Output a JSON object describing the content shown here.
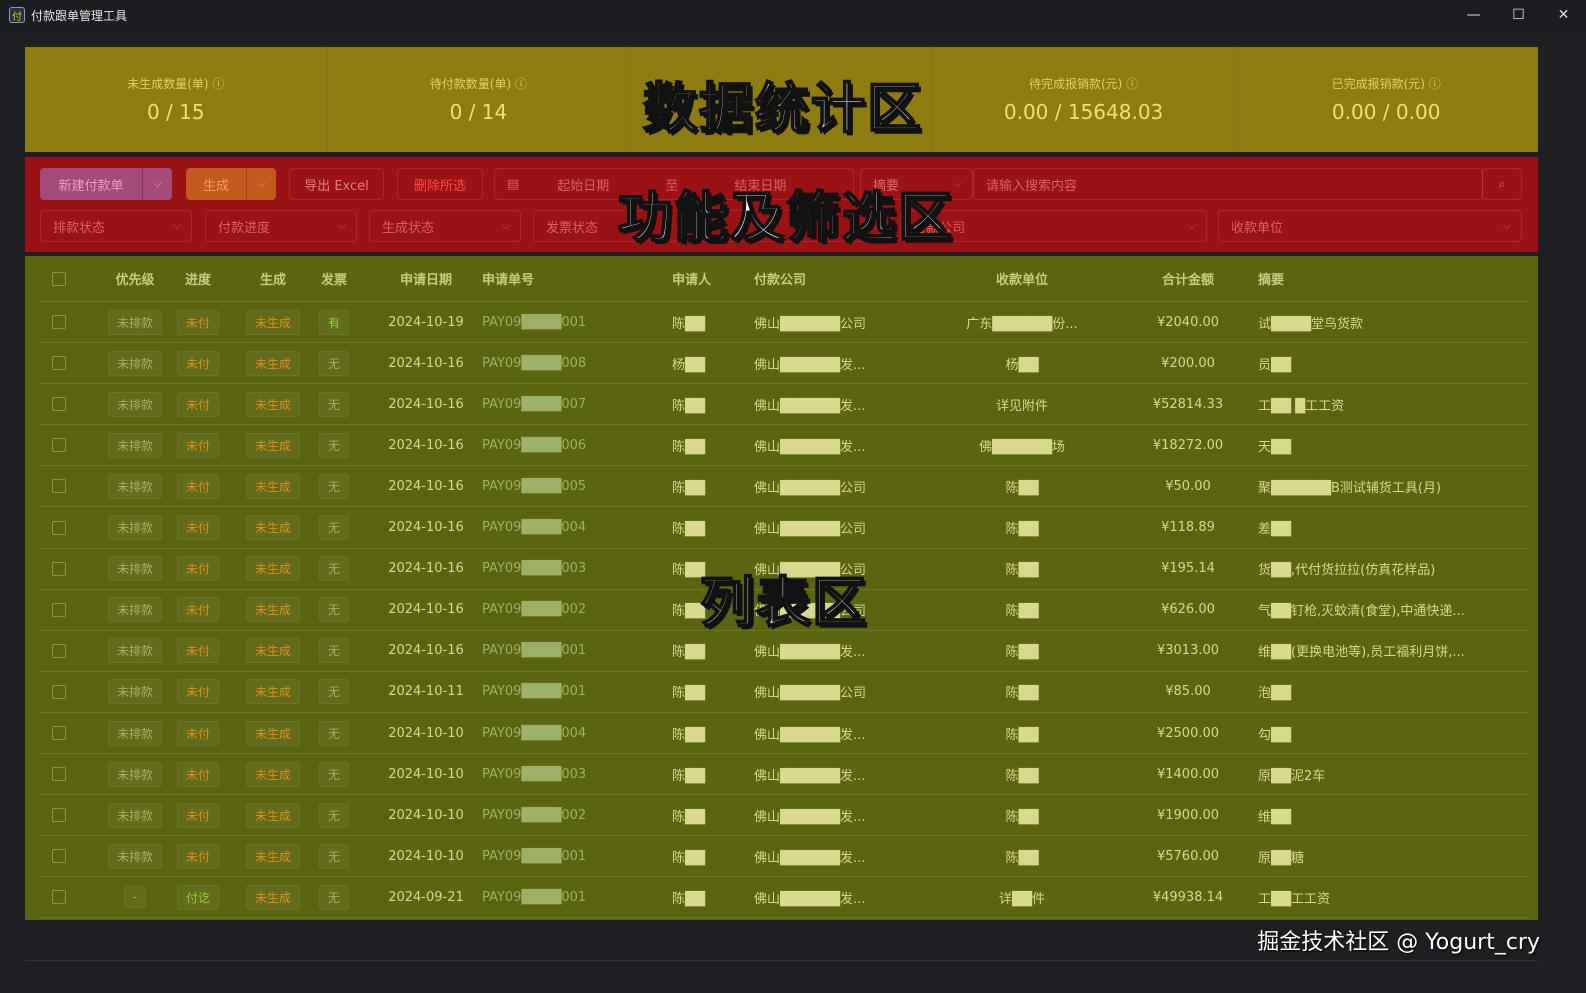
{
  "window": {
    "title": "付款跟单管理工具",
    "icon": "付",
    "controls": [
      "—",
      "☐",
      "✕"
    ]
  },
  "overlays": {
    "stats": "数据统计区",
    "filters": "功能及筛选区",
    "list": "列表区"
  },
  "stats": [
    {
      "label": "未生成数量(单)",
      "value": "0 / 15"
    },
    {
      "label": "待付款数量(单)",
      "value": "0 / 14"
    },
    {
      "label": "",
      "value": ""
    },
    {
      "label": "待完成报销款(元)",
      "value": "0.00 / 15648.03"
    },
    {
      "label": "已完成报销款(元)",
      "value": "0.00 / 0.00"
    }
  ],
  "toolbar": {
    "new_label": "新建付款单",
    "gen_label": "生成",
    "export_label": "导出 Excel",
    "delete_label": "删除所选",
    "start_date": "起始日期",
    "to": "至",
    "end_date": "结束日期",
    "search_field": "摘要",
    "search_placeholder": "请输入搜索内容"
  },
  "filters": {
    "schedule": "排款状态",
    "progress": "付款进度",
    "gen_status": "生成状态",
    "invoice": "发票状态",
    "company": "付款公司",
    "payee": "收款单位"
  },
  "table": {
    "headers": [
      "优先级",
      "进度",
      "生成",
      "发票",
      "申请日期",
      "申请单号",
      "申请人",
      "付款公司",
      "收款单位",
      "合计金额",
      "摘要"
    ],
    "rows": [
      [
        "未排款",
        "未付",
        "未生成",
        "有",
        "2024-10-19",
        "PAY09████001",
        "陈██",
        "佛山██████公司",
        "广东██████份...",
        "¥2040.00",
        "试████堂鸟货款"
      ],
      [
        "未排款",
        "未付",
        "未生成",
        "无",
        "2024-10-16",
        "PAY09████008",
        "杨██",
        "佛山██████发...",
        "杨██",
        "¥200.00",
        "员██"
      ],
      [
        "未排款",
        "未付",
        "未生成",
        "无",
        "2024-10-16",
        "PAY09████007",
        "陈██",
        "佛山██████发...",
        "详见附件",
        "¥52814.33",
        "工██  █工工资"
      ],
      [
        "未排款",
        "未付",
        "未生成",
        "无",
        "2024-10-16",
        "PAY09████006",
        "陈██",
        "佛山██████发...",
        "佛██████场",
        "¥18272.00",
        "天██"
      ],
      [
        "未排款",
        "未付",
        "未生成",
        "无",
        "2024-10-16",
        "PAY09████005",
        "陈██",
        "佛山██████公司",
        "陈██",
        "¥50.00",
        "聚██████B测试辅货工具(月)"
      ],
      [
        "未排款",
        "未付",
        "未生成",
        "无",
        "2024-10-16",
        "PAY09████004",
        "陈██",
        "佛山██████公司",
        "陈██",
        "¥118.89",
        "差██"
      ],
      [
        "未排款",
        "未付",
        "未生成",
        "无",
        "2024-10-16",
        "PAY09████003",
        "陈██",
        "佛山██████公司",
        "陈██",
        "¥195.14",
        "货██,代付货拉拉(仿真花样品)"
      ],
      [
        "未排款",
        "未付",
        "未生成",
        "无",
        "2024-10-16",
        "PAY09████002",
        "陈██",
        "佛山██████公司",
        "陈██",
        "¥626.00",
        "气██钉枪,灭蚊清(食堂),中通快递..."
      ],
      [
        "未排款",
        "未付",
        "未生成",
        "无",
        "2024-10-16",
        "PAY09████001",
        "陈██",
        "佛山██████发...",
        "陈██",
        "¥3013.00",
        "维██(更换电池等),员工福利月饼,..."
      ],
      [
        "未排款",
        "未付",
        "未生成",
        "无",
        "2024-10-11",
        "PAY09████001",
        "陈██",
        "佛山██████公司",
        "陈██",
        "¥85.00",
        "泡██"
      ],
      [
        "未排款",
        "未付",
        "未生成",
        "无",
        "2024-10-10",
        "PAY09████004",
        "陈██",
        "佛山██████发...",
        "陈██",
        "¥2500.00",
        "勾██"
      ],
      [
        "未排款",
        "未付",
        "未生成",
        "无",
        "2024-10-10",
        "PAY09████003",
        "陈██",
        "佛山██████发...",
        "陈██",
        "¥1400.00",
        "原██泥2车"
      ],
      [
        "未排款",
        "未付",
        "未生成",
        "无",
        "2024-10-10",
        "PAY09████002",
        "陈██",
        "佛山██████发...",
        "陈██",
        "¥1900.00",
        "维██"
      ],
      [
        "未排款",
        "未付",
        "未生成",
        "无",
        "2024-10-10",
        "PAY09████001",
        "陈██",
        "佛山██████发...",
        "陈██",
        "¥5760.00",
        "原██糖"
      ],
      [
        "-",
        "付讫",
        "未生成",
        "无",
        "2024-09-21",
        "PAY09████001",
        "陈██",
        "佛山██████发...",
        "详██件",
        "¥49938.14",
        "工██工工资"
      ]
    ]
  },
  "watermark": "掘金技术社区 @ Yogurt_cry"
}
